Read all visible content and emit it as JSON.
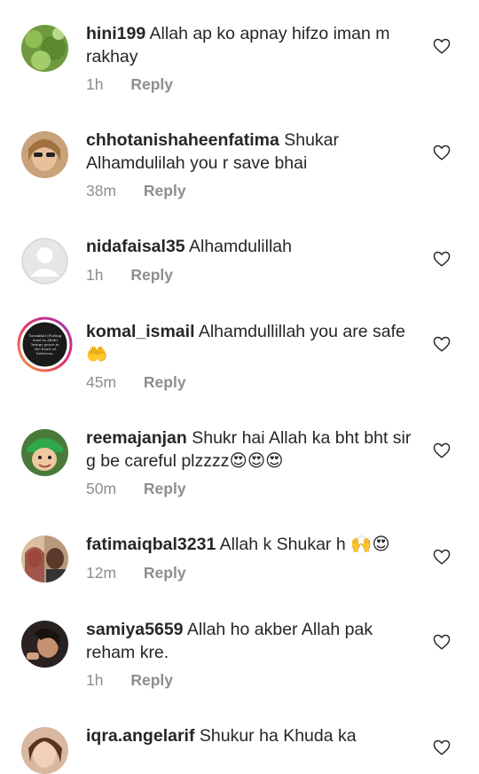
{
  "comments": [
    {
      "username": "hini199",
      "text": "Allah ap ko apnay hifzo iman m rakhay",
      "time": "1h",
      "reply": "Reply"
    },
    {
      "username": "chhotanishaheenfatima",
      "text": "Shukar Alhamdulilah you r save bhai",
      "time": "38m",
      "reply": "Reply"
    },
    {
      "username": "nidafaisal35",
      "text": "Alhamdulillah",
      "time": "1h",
      "reply": "Reply"
    },
    {
      "username": "komal_ismail",
      "text": "Alhamdullillah you are safe",
      "emoji": "🤲",
      "time": "45m",
      "reply": "Reply",
      "avatar_text": "Tawakkul (Putting trust in Allah) brings peace in the heart of believers."
    },
    {
      "username": "reemajanjan",
      "text": "Shukr hai Allah ka bht bht sir g be careful plzzzz",
      "emoji": "😍😍😍",
      "time": "50m",
      "reply": "Reply"
    },
    {
      "username": "fatimaiqbal3231",
      "text": "Allah k Shukar h",
      "emoji": "🙌😍",
      "time": "12m",
      "reply": "Reply"
    },
    {
      "username": "samiya5659",
      "text": "Allah ho akber Allah pak reham kre.",
      "time": "1h",
      "reply": "Reply"
    },
    {
      "username": "iqra.angelarif",
      "text": "Shukur ha Khuda ka",
      "time": "",
      "reply": ""
    }
  ],
  "icons": {
    "like": "heart-outline-icon"
  },
  "colors": {
    "text": "#262626",
    "meta": "#8e8e8e",
    "background": "#ffffff"
  }
}
